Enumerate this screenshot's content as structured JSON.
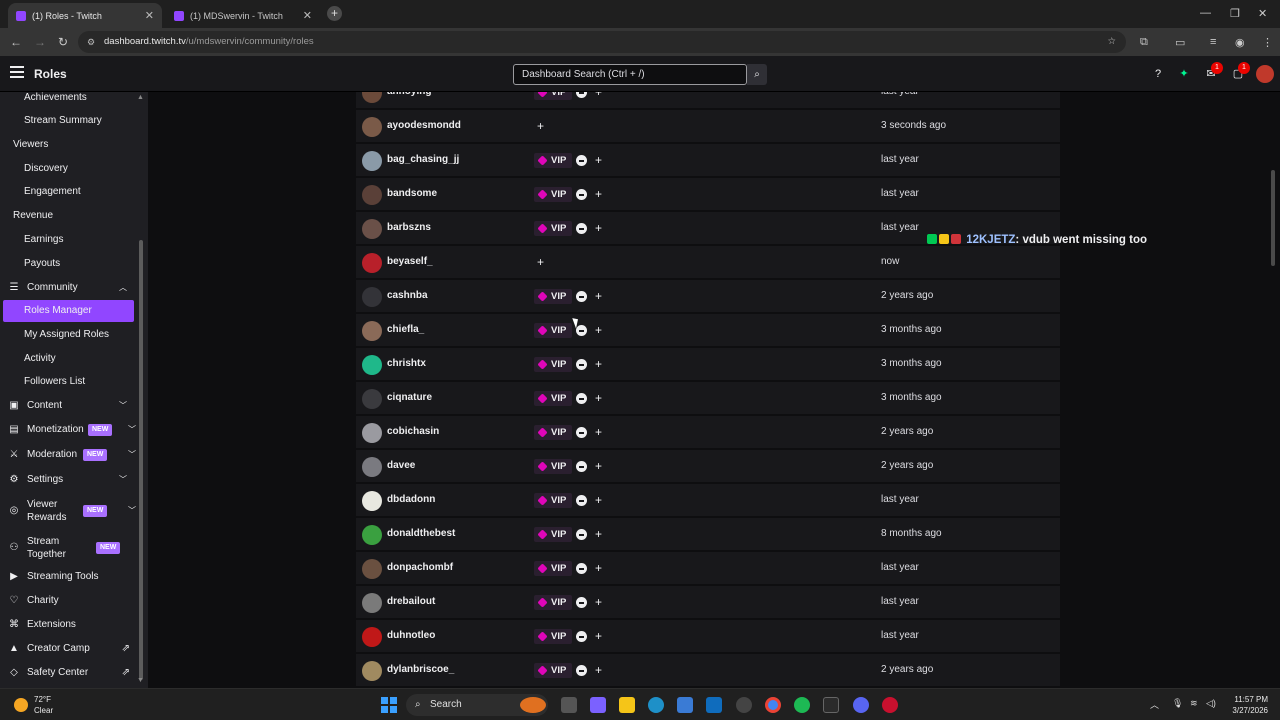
{
  "browser": {
    "tabs": [
      {
        "title": "(1) Roles - Twitch",
        "active": true
      },
      {
        "title": "(1) MDSwervin - Twitch",
        "active": false
      }
    ],
    "url_host": "dashboard.twitch.tv",
    "url_path": "/u/mdswervin/community/roles"
  },
  "topnav": {
    "title": "Roles",
    "search_placeholder": "Dashboard Search (Ctrl + /)",
    "notif_count_1": "1",
    "notif_count_2": "1"
  },
  "sidebar": {
    "items": [
      {
        "label": "Achievements"
      },
      {
        "label": "Stream Summary"
      },
      {
        "label": "Viewers"
      },
      {
        "label": "Discovery"
      },
      {
        "label": "Engagement"
      },
      {
        "label": "Revenue"
      },
      {
        "label": "Earnings"
      },
      {
        "label": "Payouts"
      },
      {
        "label": "Community"
      },
      {
        "label": "Roles Manager"
      },
      {
        "label": "My Assigned Roles"
      },
      {
        "label": "Activity"
      },
      {
        "label": "Followers List"
      },
      {
        "label": "Content"
      },
      {
        "label": "Monetization"
      },
      {
        "label": "Moderation"
      },
      {
        "label": "Settings"
      },
      {
        "label": "Viewer Rewards"
      },
      {
        "label": "Stream Together"
      },
      {
        "label": "Streaming Tools"
      },
      {
        "label": "Charity"
      },
      {
        "label": "Extensions"
      },
      {
        "label": "Creator Camp"
      },
      {
        "label": "Safety Center"
      }
    ],
    "new_badge": "NEW"
  },
  "roles": {
    "vip_label": "VIP",
    "rows": [
      {
        "username": "annoying",
        "vip": true,
        "added": "last year",
        "avatar_color": "#6b4a3a"
      },
      {
        "username": "ayoodesmondd",
        "vip": false,
        "added": "3 seconds ago",
        "avatar_color": "#7a5a48"
      },
      {
        "username": "bag_chasing_jj",
        "vip": true,
        "added": "last year",
        "avatar_color": "#8a9aa8"
      },
      {
        "username": "bandsome",
        "vip": true,
        "added": "last year",
        "avatar_color": "#5a4038"
      },
      {
        "username": "barbszns",
        "vip": true,
        "added": "last year",
        "avatar_color": "#6a5048"
      },
      {
        "username": "beyaself_",
        "vip": false,
        "added": "now",
        "avatar_color": "#b8202a"
      },
      {
        "username": "cashnba",
        "vip": true,
        "added": "2 years ago",
        "avatar_color": "#333338"
      },
      {
        "username": "chiefla_",
        "vip": true,
        "added": "3 months ago",
        "avatar_color": "#8a6a58"
      },
      {
        "username": "chrishtx",
        "vip": true,
        "added": "3 months ago",
        "avatar_color": "#1fb88a"
      },
      {
        "username": "ciqnature",
        "vip": true,
        "added": "3 months ago",
        "avatar_color": "#3a3a3e"
      },
      {
        "username": "cobichasin",
        "vip": true,
        "added": "2 years ago",
        "avatar_color": "#9a9aa0"
      },
      {
        "username": "davee",
        "vip": true,
        "added": "2 years ago",
        "avatar_color": "#7a7a80"
      },
      {
        "username": "dbdadonn",
        "vip": true,
        "added": "last year",
        "avatar_color": "#e8e8e0"
      },
      {
        "username": "donaldthebest",
        "vip": true,
        "added": "8 months ago",
        "avatar_color": "#3aa040"
      },
      {
        "username": "donpachombf",
        "vip": true,
        "added": "last year",
        "avatar_color": "#6a5040"
      },
      {
        "username": "drebailout",
        "vip": true,
        "added": "last year",
        "avatar_color": "#7a7a7a"
      },
      {
        "username": "duhnotleo",
        "vip": true,
        "added": "last year",
        "avatar_color": "#c01818"
      },
      {
        "username": "dylanbriscoe_",
        "vip": true,
        "added": "2 years ago",
        "avatar_color": "#a08a60"
      }
    ]
  },
  "chat_overlay": {
    "user": "12KJETZ",
    "message": ": vdub went missing too"
  },
  "taskbar": {
    "temp": "72°F",
    "condition": "Clear",
    "search_label": "Search",
    "time": "11:57 PM",
    "date": "3/27/2026"
  },
  "colors": {
    "accent": "#9146ff",
    "vip": "#e005b9",
    "background": "#0e0e10",
    "row": "#18181b"
  }
}
